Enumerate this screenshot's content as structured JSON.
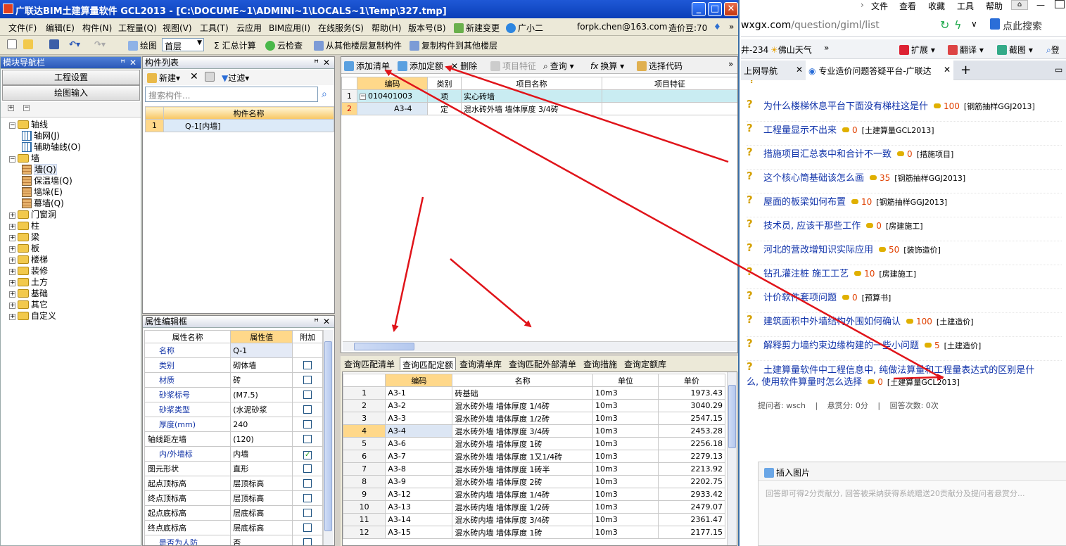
{
  "window": {
    "title": "广联达BIM土建算量软件 GCL2013 - [C:\\DOCUME~1\\ADMINI~1\\LOCALS~1\\Temp\\327.tmp]",
    "min": "_",
    "max": "□",
    "close": "✕"
  },
  "menu": [
    "文件(F)",
    "编辑(E)",
    "构件(N)",
    "工程量(Q)",
    "视图(V)",
    "工具(T)",
    "云应用",
    "BIM应用(I)",
    "在线服务(S)",
    "帮助(H)",
    "版本号(B)",
    "新建变更",
    "广小二"
  ],
  "account": {
    "email": "forpk.chen@163.com",
    "beans_label": "造价豆:70",
    "more": "»"
  },
  "toolbar": {
    "draw": "绘图",
    "floor": "首层",
    "sum": "汇总计算",
    "cloud_check": "云检查",
    "copy_from": "从其他楼层复制构件",
    "copy_to": "复制构件到其他楼层"
  },
  "nav": {
    "title": "模块导航栏",
    "pin": "ꟸ",
    "close": "✕",
    "btn_project": "工程设置",
    "btn_draw": "绘图输入",
    "tree": [
      {
        "label": "轴线",
        "level": 0,
        "type": "folder",
        "exp": "−"
      },
      {
        "label": "轴网(J)",
        "level": 1,
        "type": "grid"
      },
      {
        "label": "辅助轴线(O)",
        "level": 1,
        "type": "grid"
      },
      {
        "label": "墙",
        "level": 0,
        "type": "folder",
        "exp": "−"
      },
      {
        "label": "墙(Q)",
        "level": 1,
        "type": "item"
      },
      {
        "label": "保温墙(Q)",
        "level": 1,
        "type": "item"
      },
      {
        "label": "墙垛(E)",
        "level": 1,
        "type": "item"
      },
      {
        "label": "幕墙(Q)",
        "level": 1,
        "type": "item"
      },
      {
        "label": "门窗洞",
        "level": 0,
        "type": "folder",
        "exp": "+"
      },
      {
        "label": "柱",
        "level": 0,
        "type": "folder",
        "exp": "+"
      },
      {
        "label": "梁",
        "level": 0,
        "type": "folder",
        "exp": "+"
      },
      {
        "label": "板",
        "level": 0,
        "type": "folder",
        "exp": "+"
      },
      {
        "label": "楼梯",
        "level": 0,
        "type": "folder",
        "exp": "+"
      },
      {
        "label": "装修",
        "level": 0,
        "type": "folder",
        "exp": "+"
      },
      {
        "label": "土方",
        "level": 0,
        "type": "folder",
        "exp": "+"
      },
      {
        "label": "基础",
        "level": 0,
        "type": "folder",
        "exp": "+"
      },
      {
        "label": "其它",
        "level": 0,
        "type": "folder",
        "exp": "+"
      },
      {
        "label": "自定义",
        "level": 0,
        "type": "folder",
        "exp": "+"
      }
    ]
  },
  "components": {
    "title": "构件列表",
    "new": "新建",
    "filter": "过滤",
    "search_placeholder": "搜索构件...",
    "col_name": "构件名称",
    "rows": [
      {
        "n": "1",
        "name": "Q-1[内墙]"
      }
    ]
  },
  "props": {
    "title": "属性编辑框",
    "cols": [
      "属性名称",
      "属性值",
      "附加"
    ],
    "rows": [
      {
        "name": "名称",
        "value": "Q-1",
        "blue": true,
        "check": null
      },
      {
        "name": "类别",
        "value": "砌体墙",
        "blue": true,
        "check": false
      },
      {
        "name": "材质",
        "value": "砖",
        "blue": true,
        "check": false
      },
      {
        "name": "砂浆标号",
        "value": "(M7.5)",
        "blue": true,
        "check": false
      },
      {
        "name": "砂浆类型",
        "value": "(水泥砂浆",
        "blue": true,
        "check": false
      },
      {
        "name": "厚度(mm)",
        "value": "240",
        "blue": true,
        "check": false
      },
      {
        "name": "轴线距左墙",
        "value": "(120)",
        "blue": false,
        "check": false
      },
      {
        "name": "内/外墙标",
        "value": "内墙",
        "blue": true,
        "check": true
      },
      {
        "name": "图元形状",
        "value": "直形",
        "blue": false,
        "check": false
      },
      {
        "name": "起点顶标高",
        "value": "层顶标高",
        "blue": false,
        "check": false
      },
      {
        "name": "终点顶标高",
        "value": "层顶标高",
        "blue": false,
        "check": false
      },
      {
        "name": "起点底标高",
        "value": "层底标高",
        "blue": false,
        "check": false
      },
      {
        "name": "终点底标高",
        "value": "层底标高",
        "blue": false,
        "check": false
      },
      {
        "name": "是否为人防",
        "value": "否",
        "blue": true,
        "check": false
      }
    ]
  },
  "quota": {
    "add_list": "添加清单",
    "add_quota": "添加定额",
    "delete": "删除",
    "feature": "项目特征",
    "query": "查询",
    "convert": "换算",
    "choose_code": "选择代码",
    "more": "»",
    "cols": [
      "编码",
      "类别",
      "项目名称",
      "项目特征"
    ],
    "rows": [
      {
        "n": "1",
        "code": "010401003",
        "kind": "项",
        "name": "实心砖墙",
        "feature": ""
      },
      {
        "n": "2",
        "code": "A3-4",
        "kind": "定",
        "name": "混水砖外墙 墙体厚度 3/4砖",
        "feature": ""
      }
    ]
  },
  "lookup": {
    "tabs": [
      "查询匹配清单",
      "查询匹配定额",
      "查询清单库",
      "查询匹配外部清单",
      "查询措施",
      "查询定额库"
    ],
    "cols": [
      "编码",
      "名称",
      "单位",
      "单价"
    ],
    "rows": [
      {
        "n": "1",
        "code": "A3-1",
        "name": "砖基础",
        "unit": "10m3",
        "price": "1973.43"
      },
      {
        "n": "2",
        "code": "A3-2",
        "name": "混水砖外墙 墙体厚度 1/4砖",
        "unit": "10m3",
        "price": "3040.29"
      },
      {
        "n": "3",
        "code": "A3-3",
        "name": "混水砖外墙 墙体厚度 1/2砖",
        "unit": "10m3",
        "price": "2547.15"
      },
      {
        "n": "4",
        "code": "A3-4",
        "name": "混水砖外墙 墙体厚度 3/4砖",
        "unit": "10m3",
        "price": "2453.28"
      },
      {
        "n": "5",
        "code": "A3-6",
        "name": "混水砖外墙 墙体厚度 1砖",
        "unit": "10m3",
        "price": "2256.18"
      },
      {
        "n": "6",
        "code": "A3-7",
        "name": "混水砖外墙 墙体厚度 1又1/4砖",
        "unit": "10m3",
        "price": "2279.13"
      },
      {
        "n": "7",
        "code": "A3-8",
        "name": "混水砖外墙 墙体厚度 1砖半",
        "unit": "10m3",
        "price": "2213.92"
      },
      {
        "n": "8",
        "code": "A3-9",
        "name": "混水砖外墙 墙体厚度 2砖",
        "unit": "10m3",
        "price": "2202.75"
      },
      {
        "n": "9",
        "code": "A3-12",
        "name": "混水砖内墙 墙体厚度 1/4砖",
        "unit": "10m3",
        "price": "2933.42"
      },
      {
        "n": "10",
        "code": "A3-13",
        "name": "混水砖内墙 墙体厚度 1/2砖",
        "unit": "10m3",
        "price": "2479.07"
      },
      {
        "n": "11",
        "code": "A3-14",
        "name": "混水砖内墙 墙体厚度 3/4砖",
        "unit": "10m3",
        "price": "2361.47"
      },
      {
        "n": "12",
        "code": "A3-15",
        "name": "混水砖内墙 墙体厚度 1砖",
        "unit": "10m3",
        "price": "2177.15"
      }
    ]
  },
  "browser": {
    "menu": [
      "文件",
      "查看",
      "收藏",
      "工具",
      "帮助"
    ],
    "url_host": "wxgx.com",
    "url_path": "/question/giml/list",
    "search_placeholder": "点此搜索",
    "fav": [
      "井-234",
      "佛山天气",
      "»",
      "扩展",
      "翻译",
      "截图",
      "登"
    ],
    "tabs": [
      "上网导航",
      "专业造价问题答疑平台-广联达",
      "+"
    ],
    "questions": [
      {
        "title": "为什么楼梯休息平台下面没有梯柱这是什",
        "pts": "100",
        "cat": "[钢筋抽样GGJ2013]"
      },
      {
        "title": "工程量显示不出来",
        "pts": "0",
        "cat": "[土建算量GCL2013]"
      },
      {
        "title": "措施项目汇总表中和合计不一致",
        "pts": "0",
        "cat": "[措施项目]"
      },
      {
        "title": "这个核心筒基础该怎么画",
        "pts": "35",
        "cat": "[钢筋抽样GGJ2013]"
      },
      {
        "title": "屋面的板梁如何布置",
        "pts": "10",
        "cat": "[钢筋抽样GGJ2013]"
      },
      {
        "title": "技术员, 应该干那些工作",
        "pts": "0",
        "cat": "[房建施工]"
      },
      {
        "title": "河北的营改增知识实际应用",
        "pts": "50",
        "cat": "[装饰造价]"
      },
      {
        "title": "钻孔灌注桩 施工工艺",
        "pts": "10",
        "cat": "[房建施工]"
      },
      {
        "title": "计价软件套项问题",
        "pts": "0",
        "cat": "[预算书]"
      },
      {
        "title": "建筑面积中外墙结构外围如何确认",
        "pts": "100",
        "cat": "[土建造价]"
      },
      {
        "title": "解释剪力墙约束边缘构建的一些小问题",
        "pts": "5",
        "cat": "[土建造价]"
      }
    ],
    "main_q_line1": "土建算量软件中工程信息中, 纯做法算量和工程量表达式的区别是什",
    "main_q_line2": "么, 使用软件算量时怎么选择",
    "main_q_pts": "0",
    "main_q_cat": "[土建算量GCL2013]",
    "asker": "提问者: wsch",
    "bounty": "悬赏分: 0分",
    "answers": "回答次数: 0次",
    "insert_image": "插入图片",
    "answer_placeholder": "回答即可得2分贡献分, 回答被采纳获得系统赠送20贡献分及提问者悬赏分..."
  }
}
